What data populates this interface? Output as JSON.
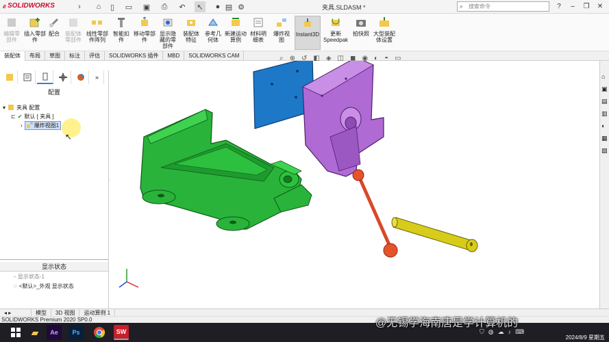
{
  "app": {
    "name": "SOLIDWORKS",
    "window_title": "夹具.SLDASM *"
  },
  "search": {
    "placeholder": "搜索命令"
  },
  "ribbon": {
    "items": [
      {
        "label": "插入零部件"
      },
      {
        "label": "配合"
      },
      {
        "label": "线性零部件阵列"
      },
      {
        "label": "智能扣件"
      },
      {
        "label": "移动零部件"
      },
      {
        "label": "显示隐藏的零部件"
      },
      {
        "label": "装配体特征"
      },
      {
        "label": "参考几何体"
      },
      {
        "label": "新建运动算例"
      },
      {
        "label": "材料明细表"
      },
      {
        "label": "爆炸视图"
      },
      {
        "label": "Instant3D"
      },
      {
        "label": "更新Speedpak"
      },
      {
        "label": "拍快照"
      },
      {
        "label": "大型装配体设置"
      }
    ],
    "dim_first": "编辑零部件",
    "dim_mid": "装配体零部件"
  },
  "cmd_tabs": [
    "装配体",
    "布局",
    "草图",
    "标注",
    "评估",
    "SOLIDWORKS 插件",
    "MBD",
    "SOLIDWORKS CAM"
  ],
  "config_panel": {
    "heading": "配置",
    "root": "夹具 配置",
    "default_config": "默认 [ 夹具 ]",
    "exploded_view": "爆炸视图1"
  },
  "display_state": {
    "heading": "显示状态",
    "state1": "显示状态-1",
    "state2": "<默认>_外观 显示状态"
  },
  "bottom_tabs": [
    "模型",
    "3D 视图",
    "运动算例 1"
  ],
  "status": {
    "text": "SOLIDWORKS Premium 2020 SP0.0"
  },
  "watermark": {
    "text": "@无锡学海南唐是学计算机的"
  },
  "clock": {
    "date": "2024/8/9 星期五"
  },
  "colors": {
    "base": "#29b33a",
    "plate": "#1e78c8",
    "jaw": "#b06ad4",
    "handle": "#e6532a",
    "screw": "#d8cc1a"
  }
}
